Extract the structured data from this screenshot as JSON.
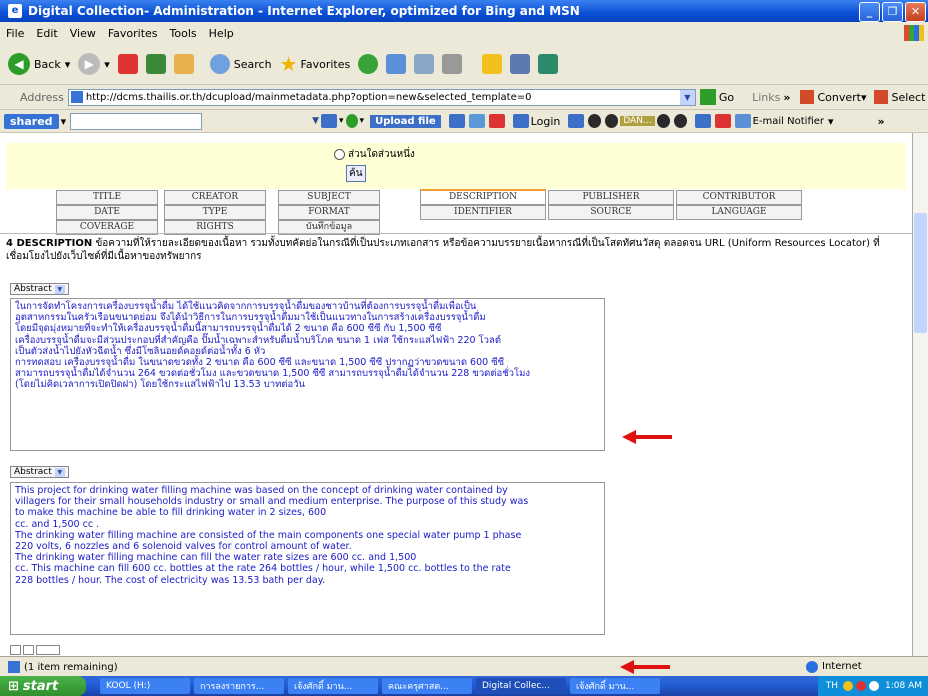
{
  "window": {
    "title": "Digital Collection- Administration - Internet Explorer, optimized for Bing and MSN"
  },
  "menu": [
    "File",
    "Edit",
    "View",
    "Favorites",
    "Tools",
    "Help"
  ],
  "toolbar": {
    "back": "Back",
    "search": "Search",
    "favorites": "Favorites"
  },
  "address": {
    "label": "Address",
    "url": "http://dcms.thailis.or.th/dcupload/mainmetadata.php?option=new&selected_template=0",
    "go": "Go",
    "links": "Links",
    "convert": "Convert",
    "select": "Select"
  },
  "linkbar": {
    "shared": "shared",
    "upload": "Upload file",
    "login": "Login",
    "dan": "DAN...",
    "email": "E-mail Notifier"
  },
  "page": {
    "radio_label": "ส่วนใดส่วนหนึ่ง",
    "find_button": "ค้น",
    "tabs_row1": [
      "TITLE",
      "CREATOR",
      "SUBJECT",
      "DESCRIPTION",
      "PUBLISHER",
      "CONTRIBUTOR"
    ],
    "tabs_row2": [
      "DATE",
      "TYPE",
      "FORMAT",
      "IDENTIFIER",
      "SOURCE",
      "LANGUAGE"
    ],
    "tabs_row3": [
      "COVERAGE",
      "RIGHTS",
      "บันทึกข้อมูล"
    ],
    "description_heading": "4 DESCRIPTION",
    "description_text": "ข้อความที่ให้รายละเอียดของเนื้อหา รวมทั้งบทคัดย่อในกรณีที่เป็นประเภทเอกสาร หรือข้อความบรรยายเนื้อหากรณีที่เป็นโสตทัศนวัสดุ ตลอดจน URL (Uniform Resources Locator) ที่เชื่อมโยงไปยังเว็บไซต์ที่มีเนื้อหาของทรัพยากร",
    "abstract_label": "Abstract",
    "abstract_thai": [
      "ในการจัดทำโครงการเครื่องบรรจุน้ำดื่ม ได้ใช้แนวคิดจากการบรรจุน้ำดื่มของชาวบ้านที่ต้องการบรรจุน้ำดื่มเพื่อเป็น",
      "อุตสาหกรรมในครัวเรือนขนาดย่อม จึงได้นำวิธีการในการบรรจุน้ำดื่มมาใช้เป็นแนวทางในการสร้างเครื่องบรรจุน้ำดื่ม",
      "โดยมีจุดมุ่งหมายที่จะทำให้เครื่องบรรจุน้ำดื่มนี้สามารถบรรจุน้ำดื่มได้ 2 ขนาด คือ 600 ซีซี กับ 1,500 ซีซี",
      "เครื่องบรรจุน้ำดื่มจะมีส่วนประกอบที่สำคัญคือ ปั๊มน้ำเฉพาะสำหรับดื่มน้ำบริโภค ขนาด 1 เฟส ใช้กระแสไฟฟ้า 220 โวลต์",
      "เป็นตัวส่งน้ำไปยังหัวฉีดน้ำ ซึ่งมีโซลินอยด์คอยด์ต่อน้ำทั้ง 6 หัว",
      "การทดสอบ เครื่องบรรจุน้ำดื่ม ในขนาดขวดทั้ง 2 ขนาด คือ 600 ซีซี และขนาด 1,500 ซีซี ปรากฏว่าขวดขนาด 600 ซีซี",
      "สามารถบรรจุน้ำดื่มได้จำนวน 264 ขวดต่อชั่วโมง และขวดขนาด 1,500 ซีซี สามารถบรรจุน้ำดื่มได้จำนวน 228 ขวดต่อชั่วโมง",
      "(โดยไม่คิดเวลาการเปิดปิดฝา) โดยใช้กระแสไฟฟ้าไป 13.53 บาทต่อวัน"
    ],
    "abstract_english": [
      "This project for drinking water filling machine was based on the concept of drinking water contained by",
      "villagers for their small households industry or small and medium enterprise. The purpose of this study was",
      "to make this machine be able to fill drinking water in 2 sizes, 600",
      "cc. and 1,500 cc .",
      "The drinking water filling machine are consisted of the main components one special water pump 1 phase",
      "220 volts, 6 nozzles and 6 solenoid valves for control amount of water.",
      "The drinking water filling machine can fill the water rate sizes are 600 cc. and 1,500",
      "cc. This machine can fill 600 cc. bottles at the rate 264 bottles / hour, while 1,500 cc. bottles to the rate",
      "228 bottles / hour. The cost of electricity was 13.53 bath per day."
    ]
  },
  "status": {
    "text": "(1 item remaining)",
    "zone": "Internet"
  },
  "taskbar": {
    "start": "start",
    "tasks": [
      "KOOL (H:)",
      "การลงรายการ...",
      "เจ้งศักดิ์ มาน...",
      "คณะครุศาสต...",
      "Digital Collec...",
      "เจ้งศักดิ์ มาน..."
    ],
    "lang": "TH",
    "time": "1:08 AM"
  },
  "colors": {
    "title_blue": "#0a4fd4",
    "abstract_text": "#1b1bc8",
    "arrow_red": "#e01010",
    "highlight": "#ffffd5"
  }
}
